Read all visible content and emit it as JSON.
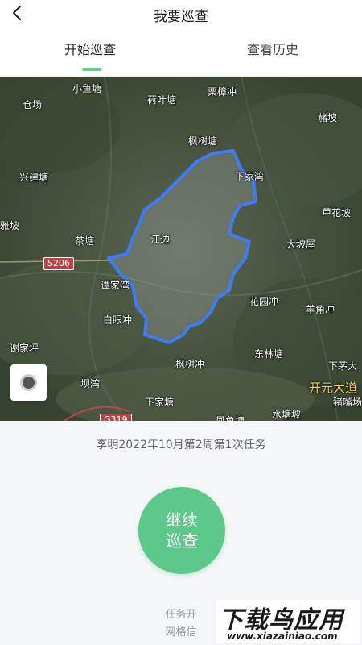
{
  "header": {
    "title": "我要巡查",
    "back_icon": "chevron-left-icon"
  },
  "tabs": [
    {
      "label": "开始巡查",
      "active": true
    },
    {
      "label": "查看历史",
      "active": false
    }
  ],
  "map": {
    "labels": {
      "xiaoyutang": "小鱼塘",
      "heyetang": "荷叶塘",
      "lizhangchong": "栗樟冲",
      "cangchang": "仓场",
      "zhepo": "赭坡",
      "fengshutang": "枫树塘",
      "xingjiantang": "兴建塘",
      "xiajiawan": "下家湾",
      "luzhupo": "芦花坡",
      "yapo": "雅坡",
      "zitang": "茶塘",
      "jiangbian": "江边",
      "dabowu": "大坡屋",
      "tanjiawan": "谭家湾",
      "xueyuchong": "花园冲",
      "baiyanchong": "白眼冲",
      "yangjiaochong": "羊角冲",
      "xiejiaping": "谢家坪",
      "banwan": "坝湾",
      "fengshuchong": "枫树冲",
      "donglintang": "东林塘",
      "xiamaoda": "下茅大",
      "xiajiatang": "下家塘",
      "shuitangpo": "水塘坡",
      "kaiyuandadao": "开元大道",
      "zhuchang": "猪嘴场",
      "fengyutang": "凤鱼塘"
    },
    "road_s206": "S206",
    "road_g319": "G319",
    "boundary_color": "#3f7cf4"
  },
  "task_text": "李明2022年10月第2周第1次任务",
  "continue_button": {
    "line1": "继续",
    "line2": "巡查",
    "color": "#5cc98a"
  },
  "footer": {
    "line1": "任务开",
    "line2": "网格信"
  },
  "watermark": {
    "main": "下载鸟应用",
    "url": "www.xiazainiao.com"
  }
}
